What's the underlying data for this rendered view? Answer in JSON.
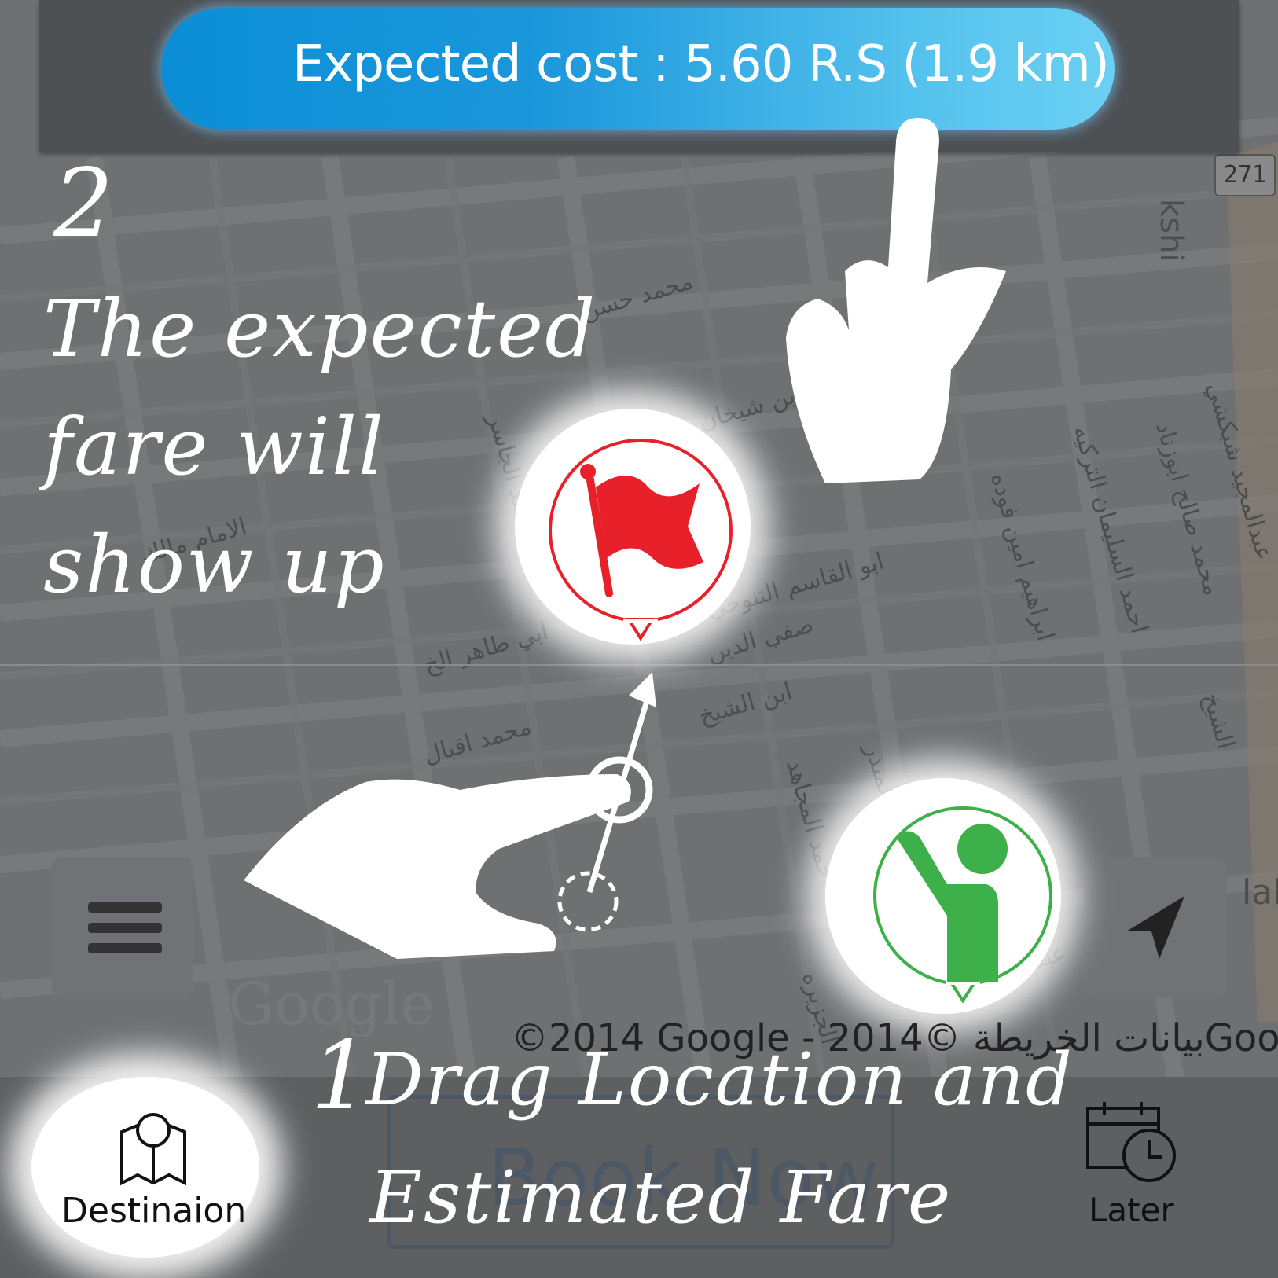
{
  "header": {
    "expected_cost_label": "Expected cost :  5.60 R.S  (1.9 km)",
    "route_badge": "271"
  },
  "map": {
    "street_labels": [
      "محمد حسن",
      "بن شيخان",
      "ابو القاسم التنوخي",
      "صفي الدين",
      "ابي طاهر الخ",
      "ابراهيم امين فوده",
      "احمد السليمان التركيه",
      "محمد صالح ابوزناد",
      "عبدالمجيد شيكشي",
      "ابن الشيخ",
      "محمد اقبال",
      "احمد المجاهد",
      "ابن المنذر",
      "الامام مالك",
      "احمد الجاسر",
      "عبدالله بن علوي",
      "الجزيره",
      "الشيخ",
      "kshi",
      "lah"
    ],
    "google_logo": "Google",
    "copyright": "©2014 Google - بيانات الخريطة ©2014Google"
  },
  "annotations": {
    "step2_number": "2",
    "step2_line1": "The expected",
    "step2_line2": "fare will",
    "step2_line3": "show up",
    "step1_number": "1",
    "step1_line1": "Drag Location and",
    "step1_line2": "Estimated Fare"
  },
  "bottom_bar": {
    "destination_label": "Destinaion",
    "book_now_label": "Book Now",
    "later_label": "Later"
  },
  "icons": {
    "menu": "hamburger-menu-icon",
    "locate": "navigation-arrow-icon",
    "destination": "map-pin-icon",
    "later": "calendar-clock-icon",
    "flag_marker": "red-flag-icon",
    "pickup_marker": "person-waving-icon"
  },
  "colors": {
    "accent_blue": "#0b8ed6",
    "flag_red": "#e8202a",
    "pickup_green": "#3db04a"
  }
}
